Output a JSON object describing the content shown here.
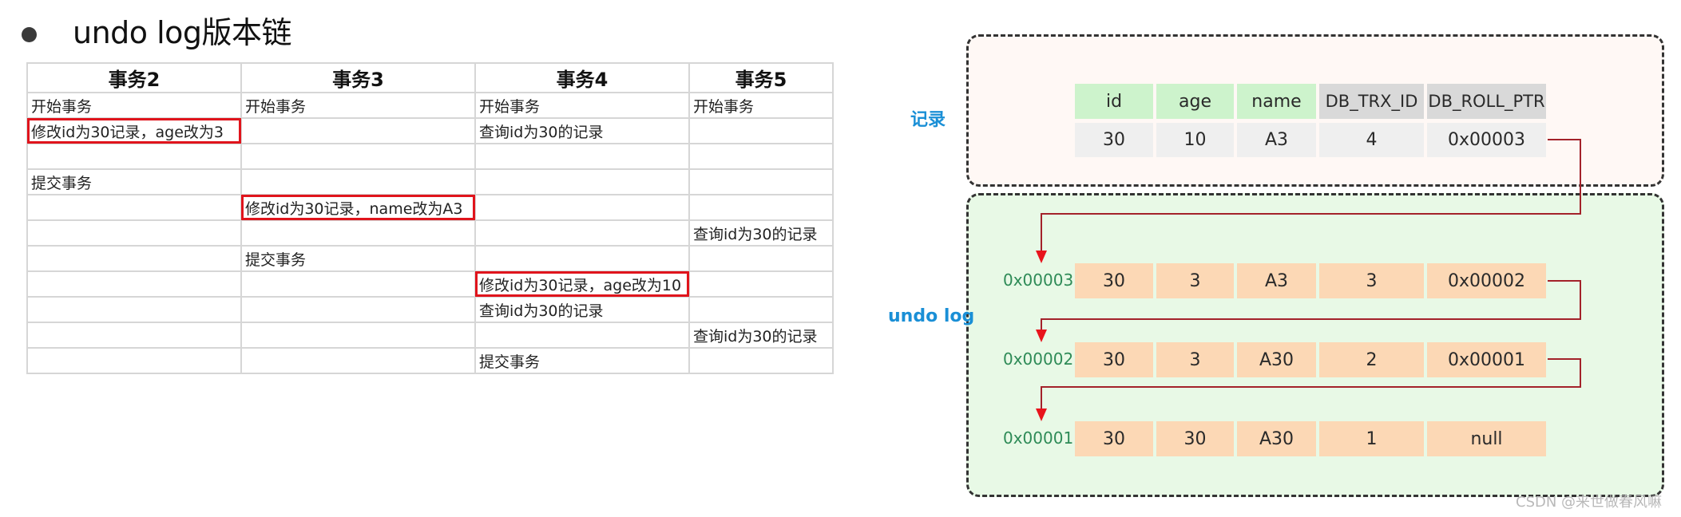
{
  "title": "undo log版本链",
  "transaction_table": {
    "headers": [
      "事务2",
      "事务3",
      "事务4",
      "事务5"
    ],
    "rows": [
      [
        "开始事务",
        "开始事务",
        "开始事务",
        "开始事务"
      ],
      [
        "修改id为30记录，age改为3",
        "",
        "查询id为30的记录",
        ""
      ],
      [
        "",
        "",
        "",
        ""
      ],
      [
        "提交事务",
        "",
        "",
        ""
      ],
      [
        "",
        "修改id为30记录，name改为A3",
        "",
        ""
      ],
      [
        "",
        "",
        "",
        "查询id为30的记录"
      ],
      [
        "",
        "提交事务",
        "",
        ""
      ],
      [
        "",
        "",
        "修改id为30记录，age改为10",
        ""
      ],
      [
        "",
        "",
        "查询id为30的记录",
        ""
      ],
      [
        "",
        "",
        "",
        "查询id为30的记录"
      ],
      [
        "",
        "",
        "提交事务",
        ""
      ]
    ],
    "highlighted_cells": [
      [
        1,
        0
      ],
      [
        4,
        1
      ],
      [
        7,
        2
      ]
    ]
  },
  "record": {
    "label": "记录",
    "columns": [
      "id",
      "age",
      "name",
      "DB_TRX_ID",
      "DB_ROLL_PTR"
    ],
    "values": [
      "30",
      "10",
      "A3",
      "4",
      "0x00003"
    ]
  },
  "undo_log": {
    "label": "undo log",
    "entries": [
      {
        "address": "0x00003",
        "values": [
          "30",
          "3",
          "A3",
          "3",
          "0x00002"
        ]
      },
      {
        "address": "0x00002",
        "values": [
          "30",
          "3",
          "A30",
          "2",
          "0x00001"
        ]
      },
      {
        "address": "0x00001",
        "values": [
          "30",
          "30",
          "A30",
          "1",
          "null"
        ]
      }
    ]
  },
  "colors": {
    "highlight_border": "#e0141c",
    "pointer_line": "#a3222a",
    "arrow_head": "#e8141c",
    "label_blue": "#1a8fd6",
    "address_green": "#2e8b57"
  },
  "watermark": "CSDN @来世做春风嘛"
}
